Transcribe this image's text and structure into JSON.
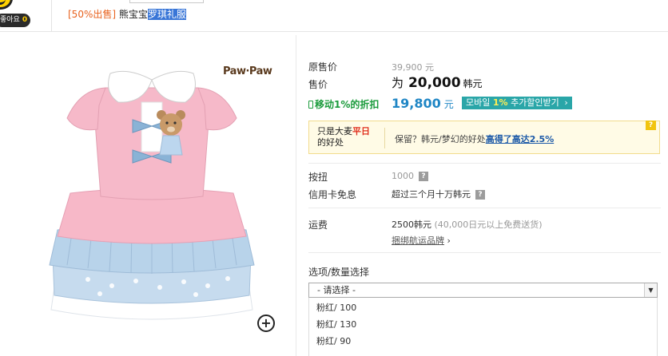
{
  "header": {
    "like_label": "좋아요",
    "like_count": "0",
    "title_tag": "[50%出售]",
    "title_brand": "熊宝宝",
    "title_highlight": "罗琪礼服"
  },
  "product_image": {
    "logo_text": "Paw·Paw",
    "zoom_label": "+"
  },
  "price": {
    "original_label": "原售价",
    "original_value": "39,900 元",
    "sale_label": "售价",
    "sale_prefix": "为",
    "sale_value": "20,000",
    "sale_unit": "韩元",
    "mobile_label": "移动1%的折扣",
    "mobile_value": "19,800",
    "mobile_unit": "元",
    "mobile_badge_pre": "모바일",
    "mobile_badge_pct": "1%",
    "mobile_badge_post": "추가할인받기",
    "mobile_badge_arrow": "›"
  },
  "promo": {
    "left_line1_pre": "只是大麦",
    "left_line1_hot": "平日",
    "left_line2": "的好处",
    "right_text": "保留？韩元/梦幻的好处",
    "right_link": "高得了高达2.5%",
    "help_icon": "?"
  },
  "details": {
    "points_label": "按扭",
    "points_value": "1000",
    "card_label": "信用卡免息",
    "card_value": "超过三个月十万韩元",
    "qmark": "?"
  },
  "shipping": {
    "label": "运费",
    "value": "2500韩元",
    "note": "(40,000日元以上免费送货)",
    "link": "捆绑航运品牌",
    "link_arrow": "›"
  },
  "options": {
    "label": "选项/数量选择",
    "placeholder": "- 请选择 -",
    "arrow": "▼",
    "items": [
      "粉红/ 100",
      "粉红/ 130",
      "粉红/ 90"
    ]
  },
  "colors": {
    "accent_orange": "#e8621e",
    "mobile_green": "#1a9b3b",
    "mobile_blue": "#1f86c5",
    "badge_teal": "#2aa6a8",
    "dress_pink": "#f6b9c9",
    "ruffle_blue": "#b8d3ea"
  }
}
